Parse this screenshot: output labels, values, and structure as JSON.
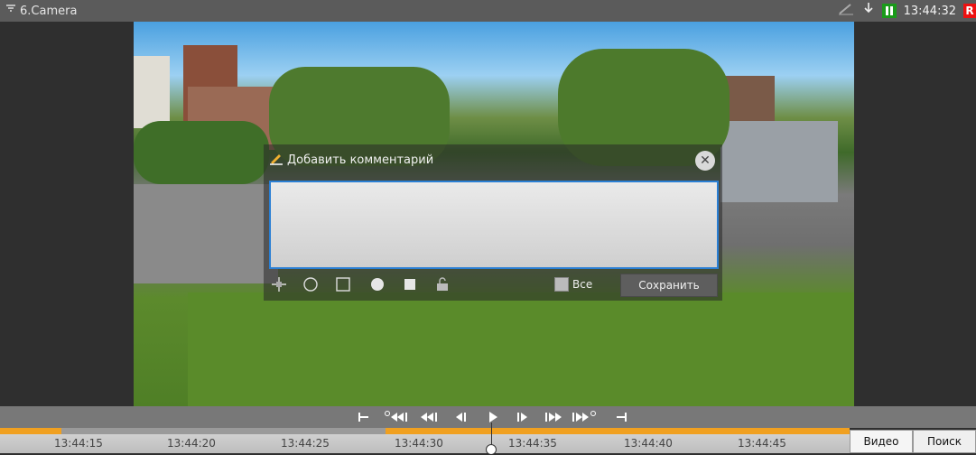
{
  "window": {
    "title": "6.Camera",
    "time": "13:44:32",
    "rec_label": "R"
  },
  "dialog": {
    "title": "Добавить комментарий",
    "comment_value": "",
    "all_label": "Все",
    "save_label": "Сохранить"
  },
  "timeline": {
    "ticks": [
      "13:44:15",
      "13:44:20",
      "13:44:25",
      "13:44:30",
      "13:44:35",
      "13:44:40",
      "13:44:45"
    ]
  },
  "mode_tabs": {
    "video": "Видео",
    "search": "Поиск"
  },
  "colors": {
    "accent_blue": "#2a7fd4",
    "timeline_orange": "#f0a020",
    "pause_green": "#1a9a1a",
    "rec_red": "#ee1111"
  }
}
